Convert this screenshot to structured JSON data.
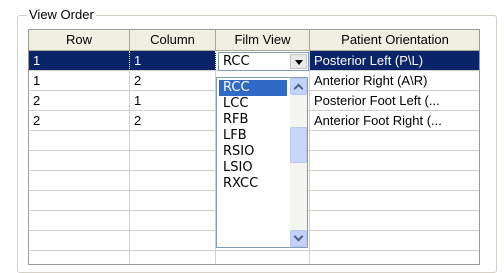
{
  "group": {
    "title": "View Order"
  },
  "table": {
    "columns": [
      "Row",
      "Column",
      "Film View",
      "Patient Orientation"
    ],
    "rows": [
      {
        "row": "1",
        "column": "1",
        "film_view": "",
        "orientation": "Posterior Left (P\\L)"
      },
      {
        "row": "1",
        "column": "2",
        "film_view": "",
        "orientation": "Anterior Right (A\\R)"
      },
      {
        "row": "2",
        "column": "1",
        "film_view": "",
        "orientation": "Posterior Foot Left (..."
      },
      {
        "row": "2",
        "column": "2",
        "film_view": "",
        "orientation": "Anterior Foot Right (..."
      }
    ],
    "selected_row": 0
  },
  "editor": {
    "value": "RCC",
    "options": [
      "RCC",
      "LCC",
      "RFB",
      "LFB",
      "RSIO",
      "LSIO",
      "RXCC"
    ],
    "selected_index": 0,
    "scroll_position": 0.5
  },
  "colors": {
    "selection": "#0a246a",
    "list_highlight": "#316ac5",
    "header_bg": "#f1efe2"
  }
}
